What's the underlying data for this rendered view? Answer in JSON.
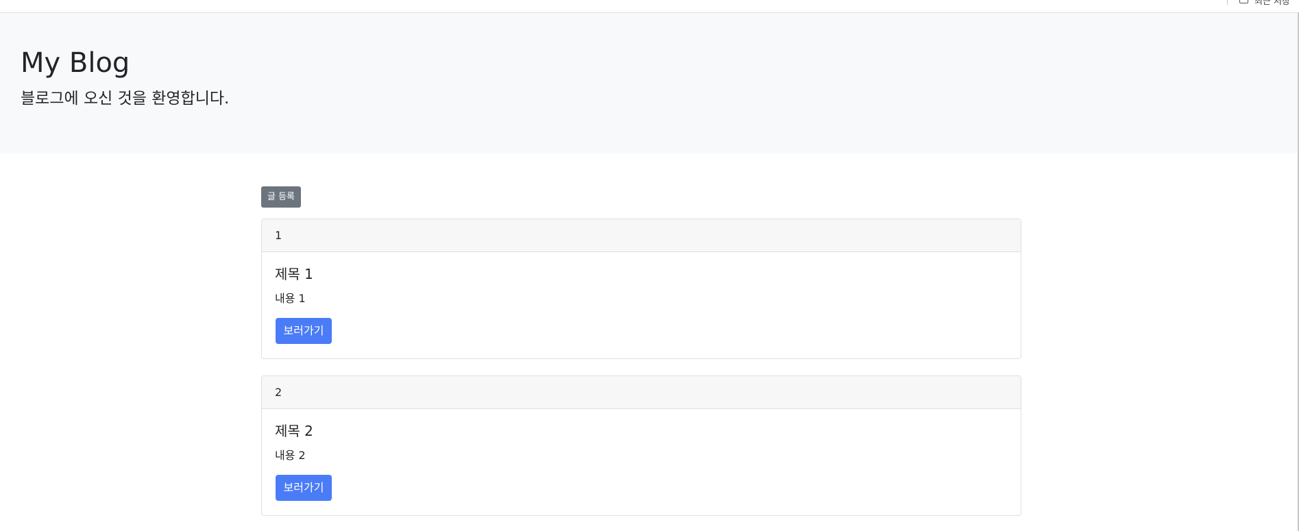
{
  "browser_top": {
    "clipped_label": "최근 저장"
  },
  "jumbotron": {
    "title": "My Blog",
    "subtitle": "블로그에 오신 것을 환영합니다."
  },
  "actions": {
    "new_post_label": "글 등록"
  },
  "posts": [
    {
      "id": "1",
      "title": "제목 1",
      "content": "내용 1",
      "button_label": "보러가기"
    },
    {
      "id": "2",
      "title": "제목 2",
      "content": "내용 2",
      "button_label": "보러가기"
    }
  ],
  "colors": {
    "primary": "#4a7cf7",
    "secondary": "#6c757d",
    "jumbotron_bg": "#f8f9fa",
    "card_header_bg": "#f7f7f7"
  }
}
